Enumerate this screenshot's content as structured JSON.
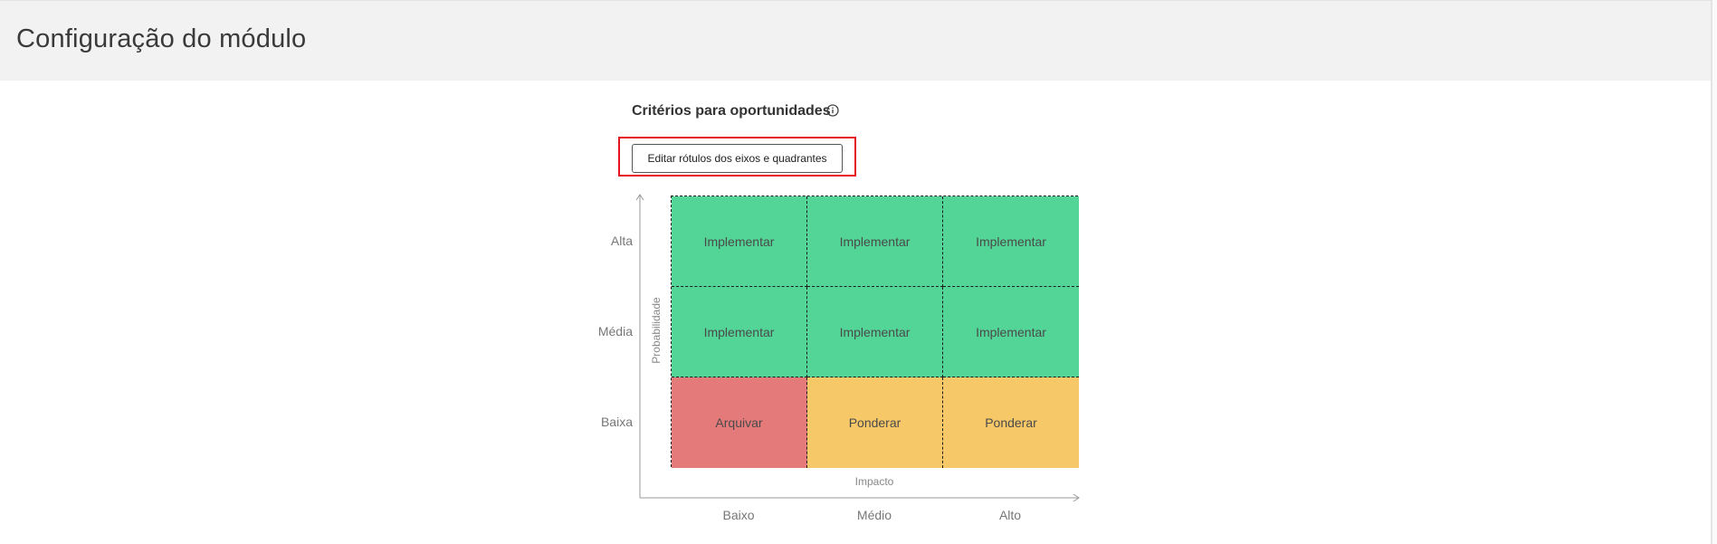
{
  "header": {
    "title": "Configuração do módulo"
  },
  "section": {
    "title": "Critérios para oportunidades",
    "info_icon": "info-circle-icon"
  },
  "edit_button": {
    "label": "Editar rótulos dos eixos e quadrantes",
    "highlight_color": "#e6141e"
  },
  "matrix": {
    "y_axis_label": "Probabilidade",
    "x_axis_label": "Impacto",
    "rows": [
      "Alta",
      "Média",
      "Baixa"
    ],
    "columns": [
      "Baixo",
      "Médio",
      "Alto"
    ],
    "cells": [
      [
        {
          "label": "Implementar",
          "color": "#53d597"
        },
        {
          "label": "Implementar",
          "color": "#53d597"
        },
        {
          "label": "Implementar",
          "color": "#53d597"
        }
      ],
      [
        {
          "label": "Implementar",
          "color": "#53d597"
        },
        {
          "label": "Implementar",
          "color": "#53d597"
        },
        {
          "label": "Implementar",
          "color": "#53d597"
        }
      ],
      [
        {
          "label": "Arquivar",
          "color": "#e47a7a"
        },
        {
          "label": "Ponderar",
          "color": "#f7c868"
        },
        {
          "label": "Ponderar",
          "color": "#f7c868"
        }
      ]
    ]
  }
}
